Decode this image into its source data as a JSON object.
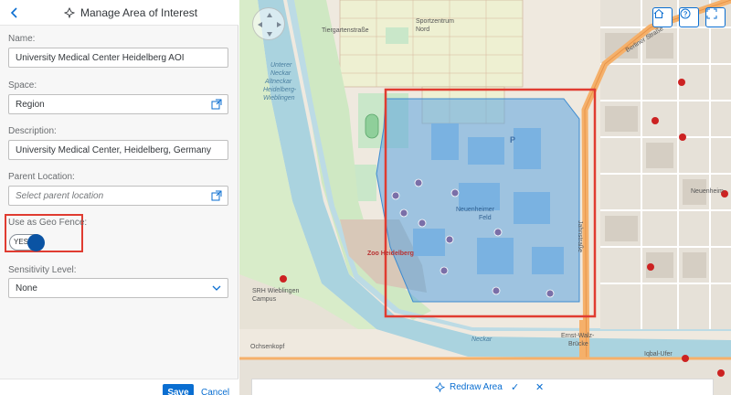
{
  "header": {
    "title": "Manage Area of Interest",
    "back_icon": "chevron-left-icon",
    "title_icon": "map-pin-icon"
  },
  "form": {
    "name": {
      "label": "Name:",
      "value": "University Medical Center Heidelberg AOI"
    },
    "space": {
      "label": "Space:",
      "value": "Region"
    },
    "description": {
      "label": "Description:",
      "value": "University Medical Center, Heidelberg, Germany"
    },
    "parent": {
      "label": "Parent Location:",
      "placeholder": "Select parent location"
    },
    "geofence": {
      "label": "Use as Geo Fence:",
      "toggle_text": "YES",
      "on": true
    },
    "sensitivity": {
      "label": "Sensitivity Level:",
      "value": "None"
    }
  },
  "footer": {
    "save": "Save",
    "cancel": "Cancel"
  },
  "map": {
    "labels": {
      "sportzentrum": "Sportzentrum",
      "nord": "Nord",
      "unterer": "Unterer",
      "neckar": "Neckar",
      "altneckar": "Altneckar",
      "heidelberg_w": "Heidelberg-",
      "wieblingen": "Wieblingen",
      "neuenheimer": "Neuenheimer",
      "feld": "Feld",
      "zoo": "Zoo Heidelberg",
      "srh": "SRH Wieblingen",
      "campus": "Campus",
      "neckar_river": "Neckar",
      "ernst": "Ernst-Walz-",
      "brucke": "Brücke",
      "ochsenkopf": "Ochsenkopf",
      "neuenh_east": "Neuenheim",
      "iqbal": "Iqbal-Ufer",
      "berliner": "Berliner Straße",
      "jahnstrasse": "Jahnstraße",
      "tiergarten": "Tiergartenstraße",
      "p": "P"
    },
    "controls": {
      "home": "home-icon",
      "help": "help-icon",
      "fullscreen": "fullscreen-icon"
    }
  },
  "toolbar": {
    "redraw": "Redraw Area"
  },
  "colors": {
    "accent": "#0a6ed1",
    "highlight": "#e03c31",
    "area_fill": "#5ba4e0",
    "toggle_on": "#0a53a3"
  }
}
